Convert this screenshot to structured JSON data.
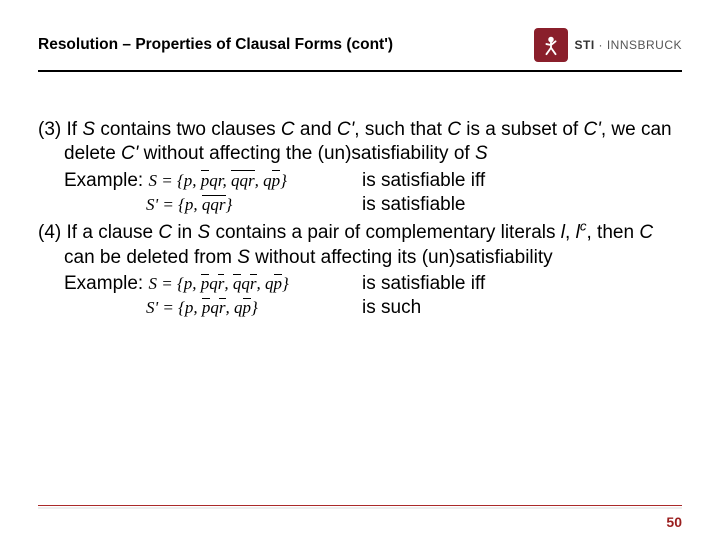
{
  "header": {
    "title": "Resolution – Properties of Clausal Forms (cont')",
    "logo_main": "STI",
    "logo_sub": " · INNSBRUCK"
  },
  "body": {
    "item3_num": "(3)",
    "item3_a": " If ",
    "item3_S": "S",
    "item3_b": " contains two clauses ",
    "item3_C": "C",
    "item3_c": " and ",
    "item3_Cp": "C'",
    "item3_d": ", such that ",
    "item3_C2": "C",
    "item3_e": "  is a subset of ",
    "item3_Cp2": "C'",
    "item3_f": ", we can delete ",
    "item3_Cp3": "C'",
    "item3_g": " without affecting the (un)satisfiability of ",
    "item3_S2": "S",
    "item3_example_label": "Example: ",
    "item3_formula1_pre": "S = {p, ",
    "item3_formula1_mid": "qr, ",
    "item3_formula1_mid2": "q",
    "item3_formula1_mid3": ", q",
    "item3_formula1_post": "}",
    "item3_sat1": " is satisfiable iff",
    "item3_formula2_pre": "S' = {p, ",
    "item3_formula2_mid": "q",
    "item3_formula2_post": "}",
    "item3_sat2": " is satisfiable",
    "item4_num": "(4)",
    "item4_a": " If a clause ",
    "item4_C": "C",
    "item4_b": " in ",
    "item4_S": "S",
    "item4_c": " contains a pair of complementary literals ",
    "item4_l": "l",
    "item4_d": ", ",
    "item4_lc": "l",
    "item4_lc_sup": "c",
    "item4_e": ", then ",
    "item4_C2": "C",
    "item4_f": " can be deleted from ",
    "item4_S2": "S",
    "item4_g": " without affecting its (un)satisfiability",
    "item4_example_label": "Example: ",
    "item4_formula1_pre": "S = {p, ",
    "item4_formula1_a": "q",
    "item4_formula1_b": ", ",
    "item4_formula1_c": "q",
    "item4_formula1_d": ", q",
    "item4_formula1_post": "}",
    "item4_sat1": " is satisfiable iff",
    "item4_formula2_pre": "S' = {p, ",
    "item4_formula2_a": "q",
    "item4_formula2_b": ", q",
    "item4_formula2_post": "}",
    "item4_sat2": " is such"
  },
  "footer": {
    "page": "50"
  }
}
